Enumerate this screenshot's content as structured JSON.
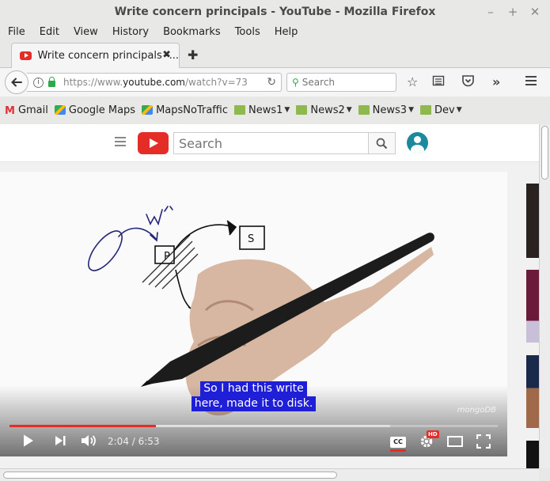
{
  "window": {
    "title": "Write concern principals - YouTube - Mozilla Firefox"
  },
  "menu": [
    "File",
    "Edit",
    "View",
    "History",
    "Bookmarks",
    "Tools",
    "Help"
  ],
  "tab": {
    "label": "Write concern principals -...",
    "close": "✖",
    "new_tab": "✚"
  },
  "navbar": {
    "url_prefix": "https://www.",
    "url_domain": "youtube.com",
    "url_rest": "/watch?v=73",
    "search_placeholder": "Search"
  },
  "bookmarks": [
    "Gmail",
    "Google Maps",
    "MapsNoTraffic",
    "News1",
    "News2",
    "News3",
    "Dev"
  ],
  "youtube": {
    "search_placeholder": "Search"
  },
  "player": {
    "caption_line1": "So I had this write",
    "caption_line2": "here, made it to disk.",
    "watermark": "mongoDB",
    "time": "2:04 / 6:53",
    "played_fraction": 0.3,
    "loaded_fraction": 0.78,
    "hd_badge": "HD",
    "cc_label": "CC",
    "drawing_labels": {
      "client": "client",
      "write": "write",
      "primary": "P",
      "secondary": "S"
    }
  }
}
